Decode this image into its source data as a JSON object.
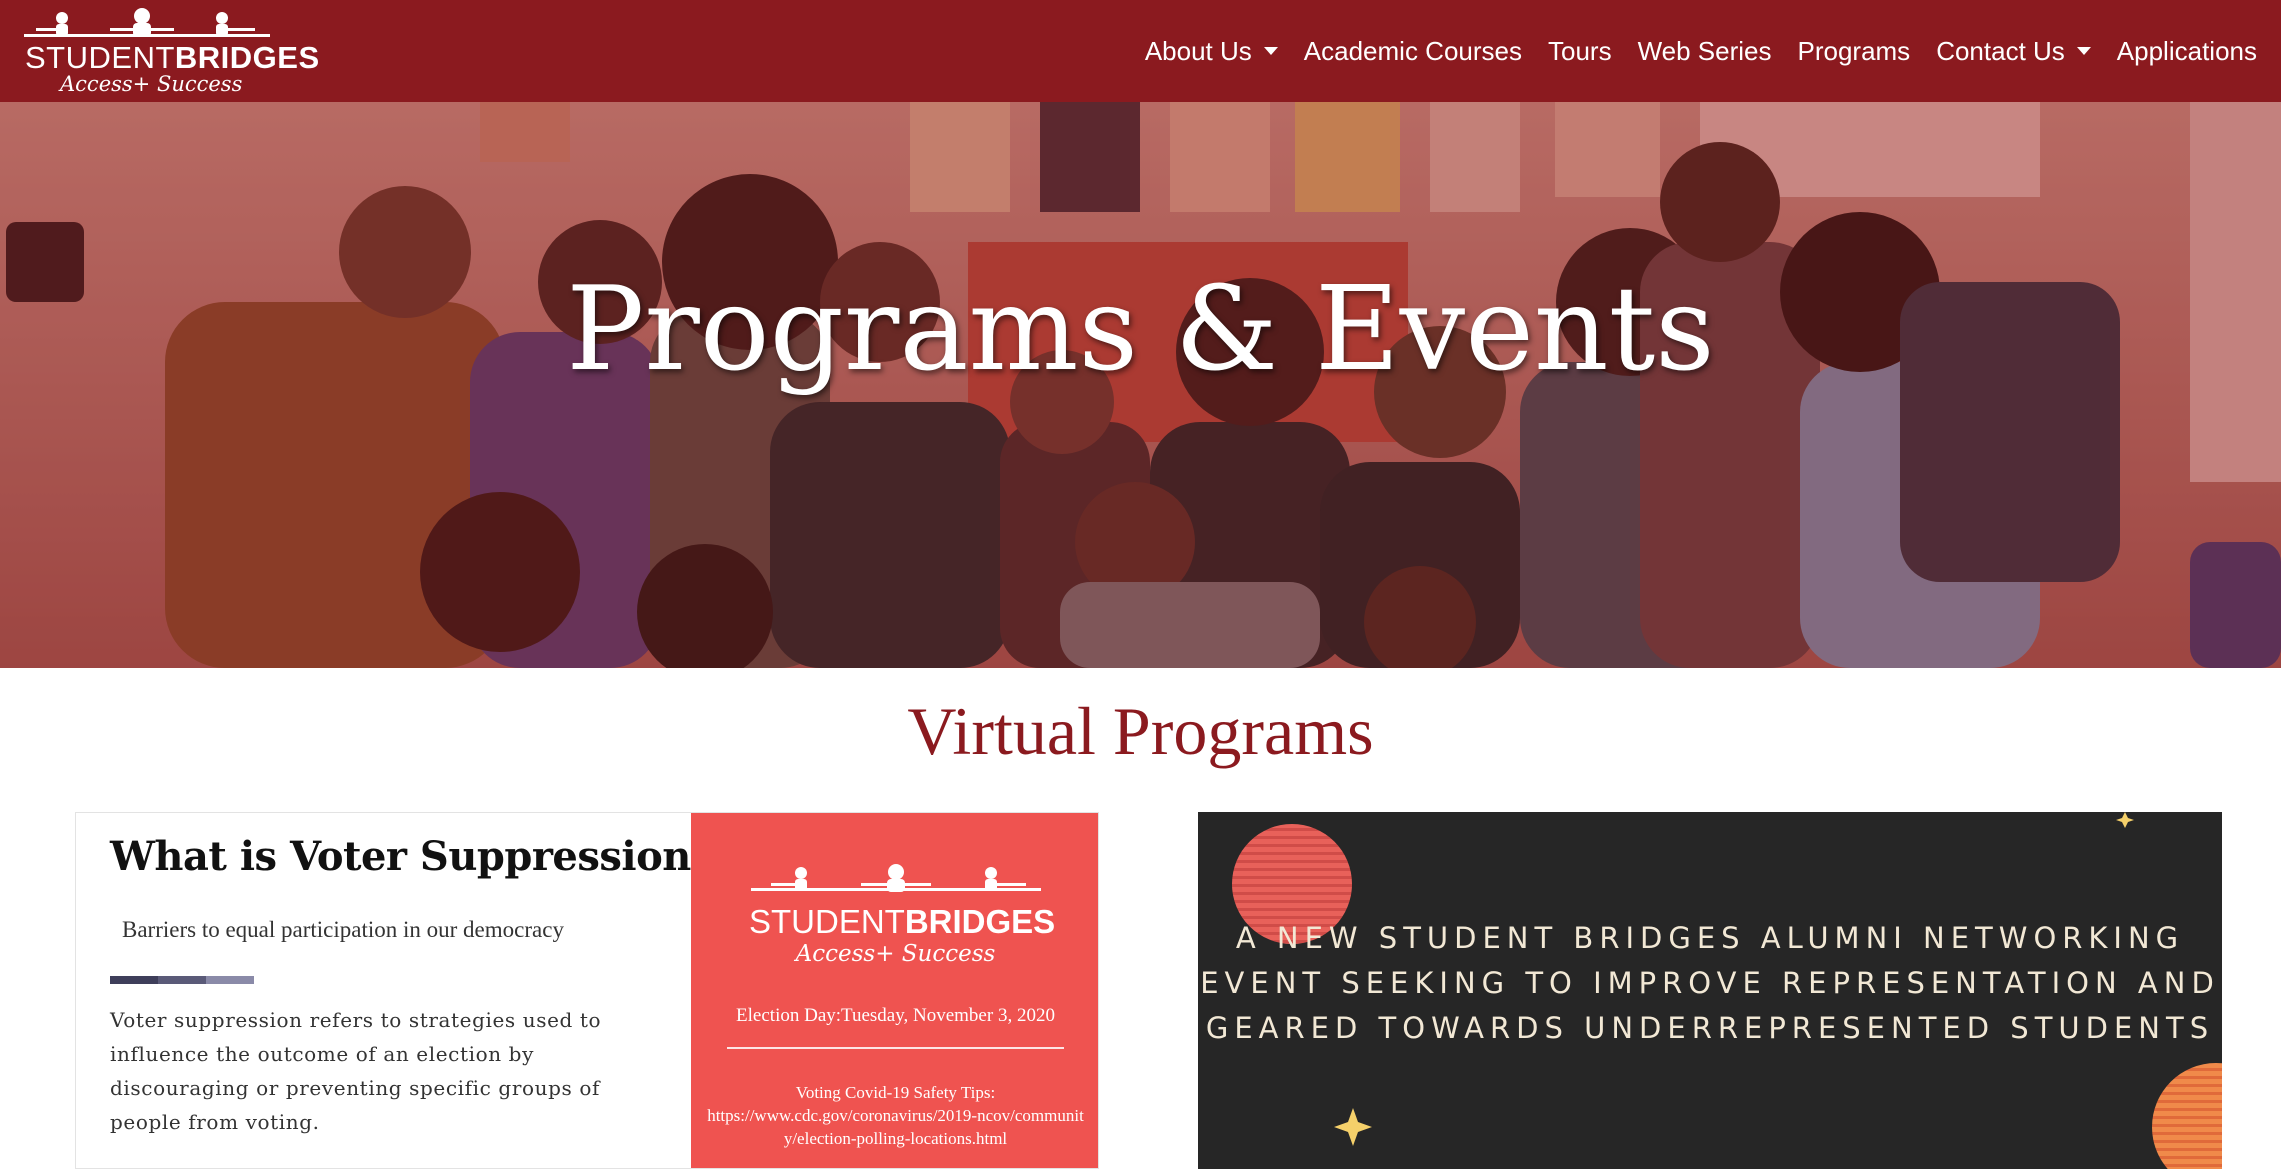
{
  "brand": {
    "name_part1": "STUDENT",
    "name_part2": "BRIDGES",
    "tagline": "Access+ Success"
  },
  "nav": {
    "items": [
      {
        "label": "About Us",
        "dropdown": true
      },
      {
        "label": "Academic Courses",
        "dropdown": false
      },
      {
        "label": "Tours",
        "dropdown": false
      },
      {
        "label": "Web Series",
        "dropdown": false
      },
      {
        "label": "Programs",
        "dropdown": false
      },
      {
        "label": "Contact Us",
        "dropdown": true
      },
      {
        "label": "Applications",
        "dropdown": false
      }
    ]
  },
  "hero": {
    "title": "Programs & Events"
  },
  "section": {
    "title": "Virtual Programs"
  },
  "card_voter": {
    "title": "What is Voter Suppression?",
    "subtitle": "Barriers to equal participation in our democracy",
    "body": "Voter suppression refers to strategies used to influence the outcome of an election by discouraging or preventing specific groups of people from voting.",
    "poster": {
      "name_part1": "STUDENT",
      "name_part2": "BRIDGES",
      "tagline": "Access+ Success",
      "election_day": "Election Day:Tuesday, November 3, 2020",
      "tips_heading": "Voting Covid-19 Safety Tips:",
      "tips_url": "https://www.cdc.gov/coronavirus/2019-ncov/community/election-polling-locations.html"
    }
  },
  "card_alumni": {
    "text": "A NEW STUDENT BRIDGES ALUMNI NETWORKING EVENT SEEKING TO IMPROVE REPRESENTATION AND GEARED TOWARDS UNDERREPRESENTED STUDENTS"
  },
  "colors": {
    "brand_red": "#8b1a1f",
    "poster_red": "#ef5350",
    "dark_card": "#262626",
    "bar_dark": "#3e3e5a",
    "bar_mid": "#5a5a78",
    "bar_light": "#8a8aa8"
  }
}
